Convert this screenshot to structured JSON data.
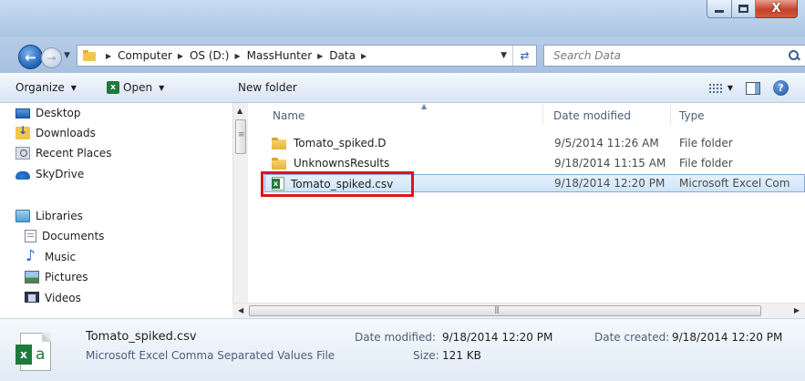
{
  "window": {
    "minimize_icon": "minimize-icon",
    "maximize_icon": "maximize-icon",
    "close_label": "X"
  },
  "address": {
    "crumbs": [
      "Computer",
      "OS (D:)",
      "MassHunter",
      "Data"
    ],
    "search_placeholder": "Search Data"
  },
  "toolbar": {
    "organize": "Organize",
    "open": "Open",
    "new_folder": "New folder"
  },
  "navpane": {
    "favorites": [
      "Desktop",
      "Downloads",
      "Recent Places",
      "SkyDrive"
    ],
    "libraries_label": "Libraries",
    "libraries": [
      "Documents",
      "Music",
      "Pictures",
      "Videos"
    ]
  },
  "filelist": {
    "columns": {
      "name": "Name",
      "date": "Date modified",
      "type": "Type"
    },
    "rows": [
      {
        "name": "Tomato_spiked.D",
        "date": "9/5/2014 11:26 AM",
        "type": "File folder",
        "icon": "folder-icon"
      },
      {
        "name": "UnknownsResults",
        "date": "9/18/2014 11:15 AM",
        "type": "File folder",
        "icon": "folder-icon"
      },
      {
        "name": "Tomato_spiked.csv",
        "date": "9/18/2014 12:20 PM",
        "type": "Microsoft Excel Com",
        "icon": "excel-csv-icon",
        "selected": true
      }
    ],
    "highlight_color": "#e0141b"
  },
  "details": {
    "name": "Tomato_spiked.csv",
    "kind": "Microsoft Excel Comma Separated Values File",
    "modified_label": "Date modified:",
    "modified_value": "9/18/2014 12:20 PM",
    "created_label": "Date created:",
    "created_value": "9/18/2014 12:20 PM",
    "size_label": "Size:",
    "size_value": "121 KB"
  },
  "colors": {
    "selection_bg": "#cfe4f8",
    "selection_border": "#84acdd",
    "title_bar": "#b9d0ea"
  }
}
